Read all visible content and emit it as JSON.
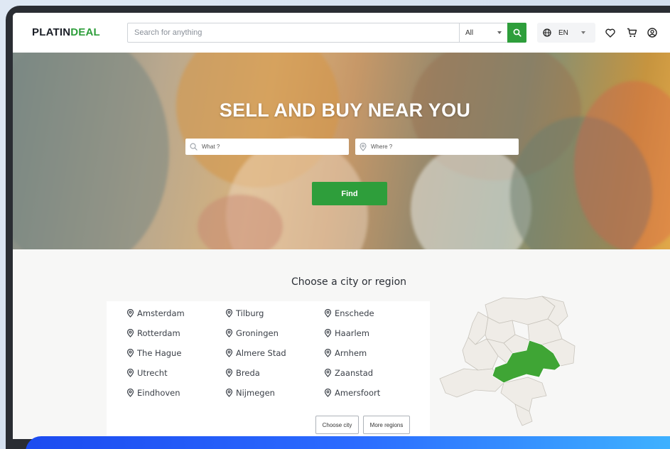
{
  "header": {
    "logo_part1": "PLATIN",
    "logo_part2": "DEAL",
    "search_placeholder": "Search for anything",
    "category_value": "All",
    "language": "EN"
  },
  "hero": {
    "title": "SELL AND BUY NEAR YOU",
    "what_placeholder": "What ?",
    "where_placeholder": "Where ?",
    "find_label": "Find"
  },
  "regions": {
    "title": "Choose a city or region",
    "cities": [
      "Amsterdam",
      "Tilburg",
      "Enschede",
      "Rotterdam",
      "Groningen",
      "Haarlem",
      "The Hague",
      "Almere Stad",
      "Arnhem",
      "Utrecht",
      "Breda",
      "Zaanstad",
      "Eindhoven",
      "Nijmegen",
      "Amersfoort"
    ],
    "choose_city_label": "Choose city",
    "more_regions_label": "More regions"
  },
  "colors": {
    "accent_green": "#2e9e3b",
    "highlight_region": "#3fa535",
    "banner_blue": "#2b6bff"
  }
}
